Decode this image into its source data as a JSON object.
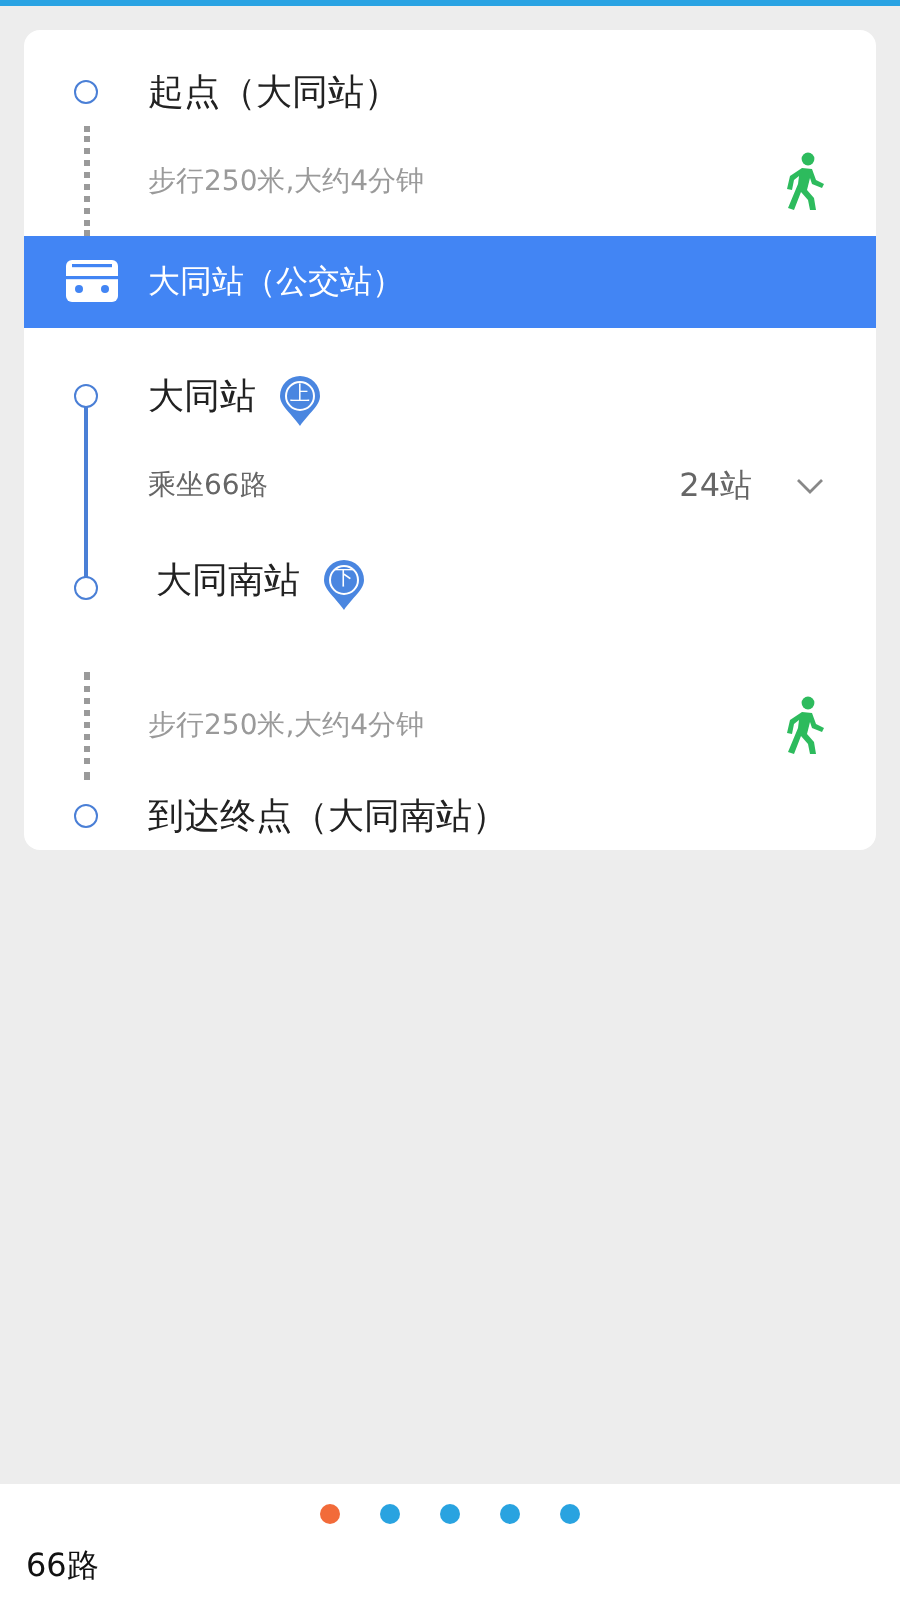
{
  "route": {
    "start": {
      "title": "起点（大同站）",
      "walk": "步行250米,大约4分钟"
    },
    "board_header": "大同站（公交站）",
    "ride": {
      "board_stop": "大同站",
      "board_badge": "上",
      "line": "乘坐66路",
      "stops": "24站",
      "expanded": false,
      "alight_stop": "大同南站",
      "alight_badge": "下"
    },
    "end": {
      "walk": "步行250米,大约4分钟",
      "title": "到达终点（大同南站）"
    }
  },
  "pager": [
    {
      "selected": true
    },
    {
      "selected": false
    },
    {
      "selected": false
    },
    {
      "selected": false
    },
    {
      "selected": false
    }
  ],
  "footer": {
    "title": "66路"
  }
}
